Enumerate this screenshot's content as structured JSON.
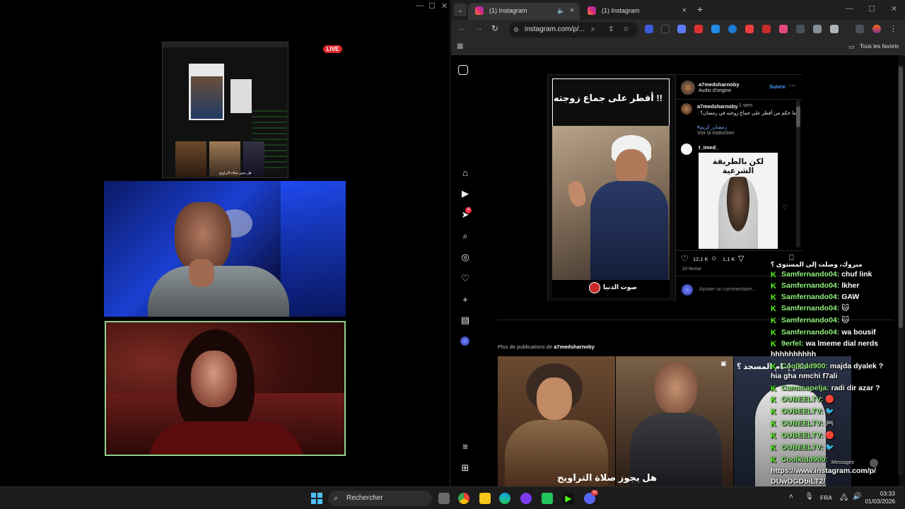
{
  "stream": {
    "live_label": "LIVE",
    "window_controls": [
      "—",
      "☐",
      "✕"
    ],
    "mini_caption": "هل يجوز صلاة التراويح"
  },
  "browser": {
    "tabs": [
      {
        "label": "(1) Instagram",
        "active": true
      },
      {
        "label": "(1) Instagram",
        "active": false
      }
    ],
    "new_tab": "+",
    "window_controls": [
      "—",
      "☐",
      "✕"
    ],
    "url": "instagram.com/p/...",
    "bookmarks_label": "Tous les favoris"
  },
  "instagram": {
    "nav_badge": "4",
    "post": {
      "title_ar": "أفطر على جماع زوجته !!",
      "watermark_ar": "صوت الدنيا",
      "author": "a7medsharnoby",
      "audio": "Audio d'origine",
      "follow": "Suivre",
      "caption_user": "a7medsharnoby",
      "caption_time": "1 sem",
      "caption_text": "ما حكم من أفطر على جماع زوجته في رمضان؟",
      "caption_tag": "#رمضان_كريم",
      "translate": "Voir la traduction",
      "comment_user": "t_imed_",
      "comment_image_text": "لكن بالطريقة الشرعية",
      "likes": "12,1 K",
      "comments": "1,1 K",
      "date": "20 février",
      "add_comment": "Ajouter un commentaire..."
    },
    "more_prefix": "Plus de publications de",
    "more_user": "a7medsharnoby",
    "thumb_caption": "هل يجوز صلاة التراويح",
    "thumb3_caption": "حكم إمام المسجد ؟"
  },
  "chat": {
    "top_partial": "مبروك، وصلت إلى المستوى ؟",
    "lines": [
      {
        "user": "Samfernando04:",
        "msg": "chuf link"
      },
      {
        "user": "Samfernando04:",
        "msg": "lkher"
      },
      {
        "user": "Samfernando04:",
        "msg": "GAW"
      },
      {
        "user": "Samfernando04:",
        "msg": "🐱"
      },
      {
        "user": "Samfernando04:",
        "msg": "🐱"
      },
      {
        "user": "Samfernando04:",
        "msg": "wa bousif"
      },
      {
        "user": "9erfel:",
        "msg": "wa lmeme dial nerds"
      }
    ],
    "wrap1": "hhhhhhhhhh",
    "cool1_user": "Coolkidd900:",
    "cool1_msg": "majda dyalek ?",
    "cool1_wrap": "hia gha nmchi f7ali",
    "cama_user": "Camacapelja:",
    "cama_msg": "radi dir azar ?",
    "oubeel": [
      {
        "user": "OUBEELTV:",
        "msg": "🔴"
      },
      {
        "user": "OUBEELTV:",
        "msg": "🐦"
      },
      {
        "user": "OUBEELTV:",
        "msg": "🎮"
      },
      {
        "user": "OUBEELTV:",
        "msg": "🔴"
      },
      {
        "user": "OUBEELTV:",
        "msg": "🐦"
      }
    ],
    "cool2_user": "Coolkidd900:",
    "messages_label": "Messages",
    "link1": "https://www.instagram.com/p/",
    "link2": "DUwOGDbiLT2/"
  },
  "taskbar": {
    "search": "Rechercher",
    "lang": "FRA",
    "time": "03:33",
    "date": "01/03/2026",
    "discord_badge": "99"
  }
}
